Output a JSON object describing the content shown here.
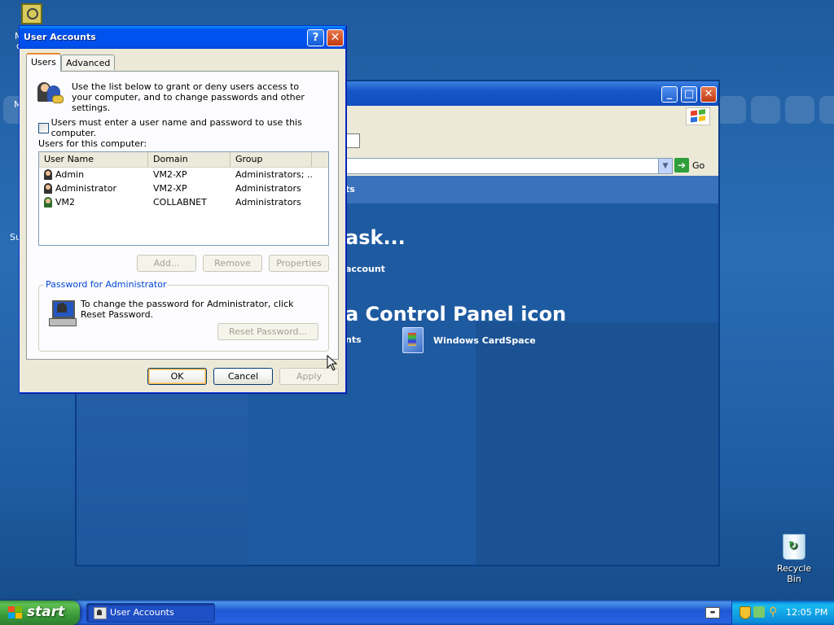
{
  "desktop": {
    "stub_top": "M",
    "stub_top2": "c",
    "stub_mid": "M",
    "stub_side": "Su",
    "recycle_label": "Recycle Bin"
  },
  "control_panel": {
    "go_label": "Go",
    "breadcrumb_partial": "ts",
    "heading_task_partial": "ask...",
    "link_account_partial": "account",
    "heading_icon_partial": "a Control Panel icon",
    "link_partial2": "nts",
    "cardspace_label": "Windows CardSpace"
  },
  "dialog": {
    "title": "User Accounts",
    "help_glyph": "?",
    "close_glyph": "✕",
    "tabs": [
      {
        "label": "Users",
        "active": true
      },
      {
        "label": "Advanced",
        "active": false
      }
    ],
    "intro_text": "Use the list below to grant or deny users access to your computer, and to change passwords and other settings.",
    "must_login_label": "Users must enter a user name and password to use this computer.",
    "must_login_checked": false,
    "users_label": "Users for this computer:",
    "columns": [
      "User Name",
      "Domain",
      "Group"
    ],
    "rows": [
      {
        "name": "Admin",
        "domain": "VM2-XP",
        "group": "Administrators; ..."
      },
      {
        "name": "Administrator",
        "domain": "VM2-XP",
        "group": "Administrators"
      },
      {
        "name": "VM2",
        "domain": "COLLABNET",
        "group": "Administrators"
      }
    ],
    "add_label": "Add...",
    "remove_label": "Remove",
    "properties_label": "Properties",
    "password_group_title": "Password for Administrator",
    "password_text": "To change the password for Administrator, click Reset Password.",
    "reset_label": "Reset Password...",
    "ok_label": "OK",
    "cancel_label": "Cancel",
    "apply_label": "Apply"
  },
  "taskbar": {
    "start_label": "start",
    "task_label": "User Accounts",
    "clock": "12:05 PM"
  }
}
